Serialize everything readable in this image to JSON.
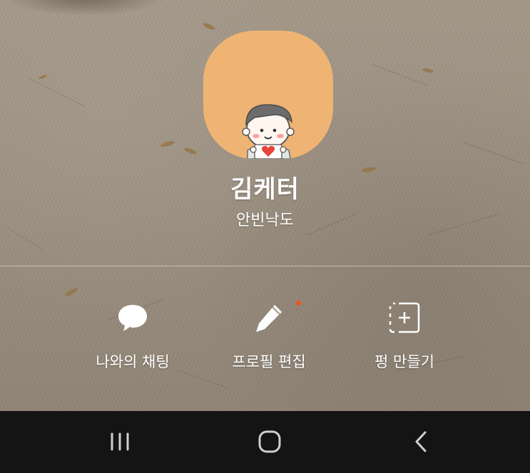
{
  "profile": {
    "name": "김케터",
    "status_message": "안빈낙도",
    "avatar_bg_color": "#efb474"
  },
  "actions": [
    {
      "label": "나와의 채팅",
      "icon": "chat-bubble-icon"
    },
    {
      "label": "프로필 편집",
      "icon": "pencil-icon",
      "has_new_badge": true
    },
    {
      "label": "펑 만들기",
      "icon": "add-dashed-square-icon"
    }
  ],
  "navigation_bar": {
    "buttons": [
      {
        "name": "recent-apps",
        "icon": "recent-apps-icon"
      },
      {
        "name": "home",
        "icon": "home-icon"
      },
      {
        "name": "back",
        "icon": "back-icon"
      }
    ],
    "background_color": "#141414"
  },
  "colors": {
    "badge": "#f0531c",
    "text": "#ffffff"
  }
}
